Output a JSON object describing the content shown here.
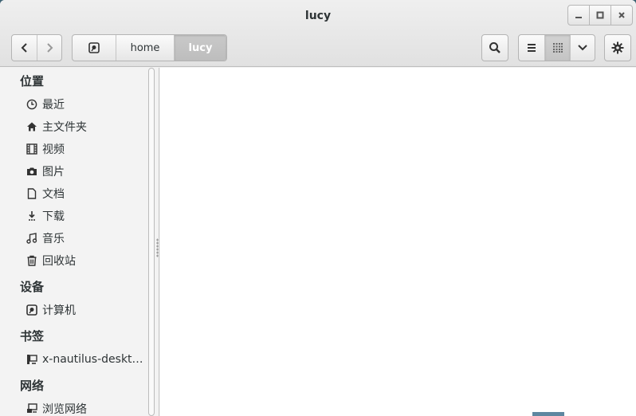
{
  "window": {
    "title": "lucy"
  },
  "window_controls": {
    "minimize": "minimize-icon",
    "maximize": "maximize-icon",
    "close": "close-icon"
  },
  "toolbar": {
    "back_icon": "chevron-left-icon",
    "forward_icon": "chevron-right-icon",
    "breadcrumb": [
      {
        "type": "icon",
        "icon": "drive-icon"
      },
      {
        "type": "text",
        "label": "home"
      },
      {
        "type": "text",
        "label": "lucy",
        "active": true
      }
    ],
    "search_icon": "search-icon",
    "view_buttons": [
      "list-view-icon",
      "grid-view-icon",
      "chevron-down-icon"
    ],
    "settings_icon": "gear-icon"
  },
  "sidebar": {
    "sections": [
      {
        "header": "位置",
        "items": [
          {
            "label": "最近",
            "icon": "clock-icon"
          },
          {
            "label": "主文件夹",
            "icon": "home-icon"
          },
          {
            "label": "视频",
            "icon": "film-icon"
          },
          {
            "label": "图片",
            "icon": "camera-icon"
          },
          {
            "label": "文档",
            "icon": "document-icon"
          },
          {
            "label": "下载",
            "icon": "download-icon"
          },
          {
            "label": "音乐",
            "icon": "music-icon"
          },
          {
            "label": "回收站",
            "icon": "trash-icon"
          }
        ]
      },
      {
        "header": "设备",
        "items": [
          {
            "label": "计算机",
            "icon": "drive-icon"
          }
        ]
      },
      {
        "header": "书签",
        "items": [
          {
            "label": "x-nautilus-deskt…",
            "icon": "desktop-icon"
          }
        ]
      },
      {
        "header": "网络",
        "items": [
          {
            "label": "浏览网络",
            "icon": "network-icon"
          }
        ]
      }
    ]
  },
  "colors": {
    "accent": "#bdbdbd",
    "content_bg": "#ffffff",
    "sidebar_bg": "#f3f3f3"
  }
}
